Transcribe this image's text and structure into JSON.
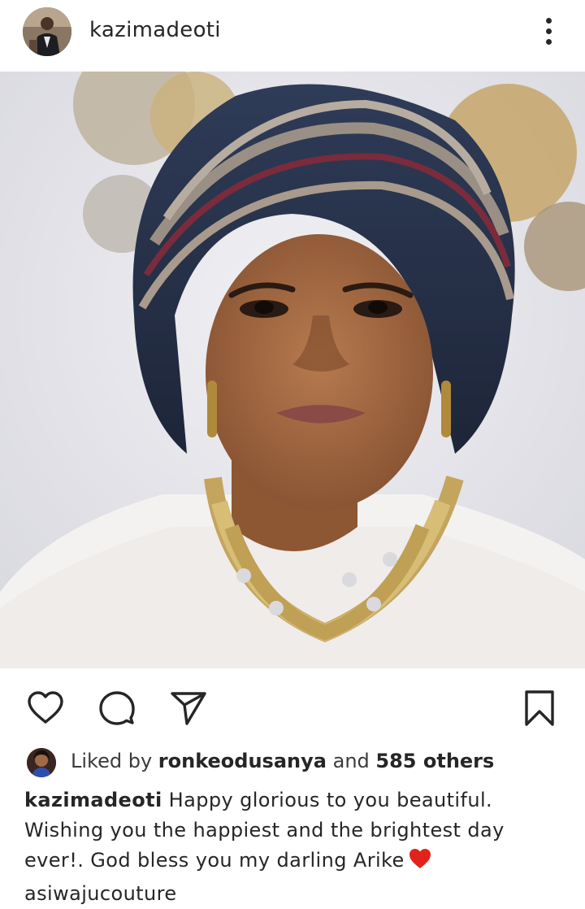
{
  "header": {
    "username": "kazimadeoti",
    "avatar_icon": "user-avatar",
    "more_icon": "more-vertical-icon"
  },
  "post": {
    "image_icon": "portrait-photo"
  },
  "actions": {
    "like_icon": "heart-outline-icon",
    "comment_icon": "comment-icon",
    "share_icon": "send-icon",
    "save_icon": "bookmark-icon"
  },
  "likes": {
    "prefix": "Liked by",
    "liker": "ronkeodusanya",
    "connector": "and",
    "others": "585 others"
  },
  "caption": {
    "username": "kazimadeoti",
    "line1": "Happy glorious to you beautiful.",
    "line2": "Wishing you the happiest and the brightest day",
    "line3": "ever!. God bless you my darling Arike",
    "line4": "asiwajucouture"
  },
  "colors": {
    "text": "#262626",
    "heart_emoji": "#e0241b"
  }
}
